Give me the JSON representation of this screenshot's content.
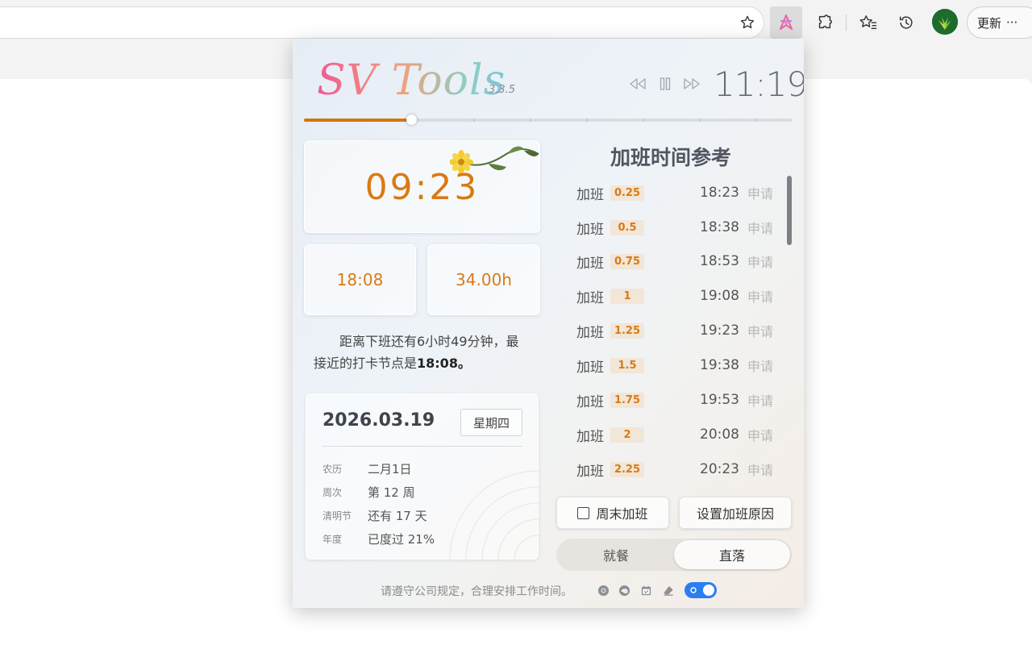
{
  "browser": {
    "update_label": "更新",
    "more_glyph": "···",
    "icons": [
      "favorite-star-icon",
      "sv-tools-extension-icon",
      "extensions-puzzle-icon",
      "favorites-icon",
      "history-icon",
      "profile-avatar"
    ]
  },
  "popup": {
    "logo": "SV Tools",
    "version": "3.3.5",
    "clock": "11:19",
    "progress_fraction": 0.22,
    "work_time": "09:23",
    "off_time": "18:08",
    "total_hours": "34.00h",
    "remaining_text": "距离下班还有6小时49分钟，最接近的打卡节点是",
    "nearest_node": "18:08",
    "remaining_suffix": "。",
    "date": {
      "date": "2026.03.19",
      "weekday": "星期四",
      "rows": [
        {
          "label": "农历",
          "value": "二月1日"
        },
        {
          "label": "周次",
          "value": "第 12 周"
        },
        {
          "label": "清明节",
          "value": "还有 17 天"
        },
        {
          "label": "年度",
          "value": "已度过 21%"
        }
      ]
    },
    "overtime": {
      "title": "加班时间参考",
      "label": "加班",
      "apply": "申请",
      "rows": [
        {
          "amount": "0.25",
          "time": "18:23"
        },
        {
          "amount": "0.5",
          "time": "18:38"
        },
        {
          "amount": "0.75",
          "time": "18:53"
        },
        {
          "amount": "1",
          "time": "19:08"
        },
        {
          "amount": "1.25",
          "time": "19:23"
        },
        {
          "amount": "1.5",
          "time": "19:38"
        },
        {
          "amount": "1.75",
          "time": "19:53"
        },
        {
          "amount": "2",
          "time": "20:08"
        },
        {
          "amount": "2.25",
          "time": "20:23"
        }
      ]
    },
    "weekend_label": "周末加班",
    "reason_label": "设置加班原因",
    "segment": {
      "left": "就餐",
      "right": "直落",
      "selected": "right"
    },
    "footer": "请遵守公司规定，合理安排工作时间。",
    "colors": {
      "accent": "#d97a14",
      "progress": "#d4760f",
      "toggle": "#2b7ef0"
    }
  }
}
